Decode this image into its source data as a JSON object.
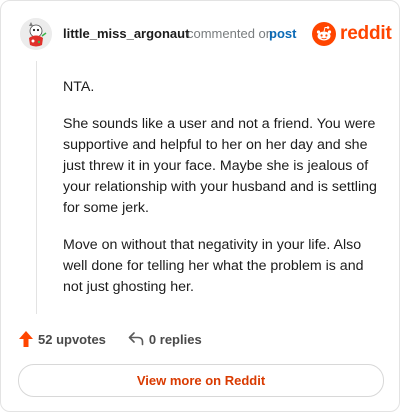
{
  "comment": {
    "username": "little_miss_argonaut",
    "meta_text": "commented on",
    "post_link": "post",
    "paragraphs": [
      "NTA.",
      "She sounds like a user and not a friend. You were supportive and helpful to her on her day and she just threw it in your face. Maybe she is jealous of your relationship with your husband and is settling for some jerk.",
      "Move on without that negativity in your life. Also well done for telling her what the problem is and not just ghosting her."
    ]
  },
  "brand": {
    "wordmark": "reddit",
    "color": "#ff4500"
  },
  "actions": {
    "upvotes": "52 upvotes",
    "replies": "0 replies"
  },
  "view_more": {
    "label": "View more on Reddit"
  },
  "icons": {
    "upvote": "upvote-arrow-icon",
    "reply": "reply-arrow-icon",
    "logo": "reddit-snoo-icon",
    "avatar": "user-avatar"
  },
  "colors": {
    "accent": "#ff4500",
    "link": "#0a6ab6",
    "button_text": "#d93a00",
    "muted": "#787c7e"
  }
}
